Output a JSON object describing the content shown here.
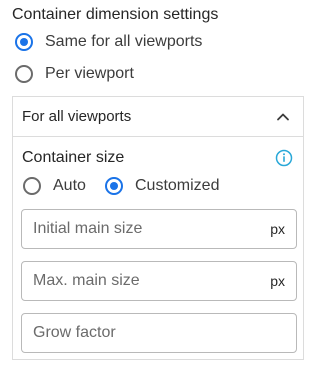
{
  "container_settings": {
    "title": "Container dimension settings",
    "viewport_options": [
      {
        "label": "Same for all viewports",
        "checked": true
      },
      {
        "label": "Per viewport",
        "checked": false
      }
    ]
  },
  "panel": {
    "header_label": "For all viewports",
    "header_icon": "chevron-up-icon",
    "container_size": {
      "title": "Container size",
      "info_icon": "info-icon",
      "options": [
        {
          "label": "Auto",
          "checked": false
        },
        {
          "label": "Customized",
          "checked": true
        }
      ]
    },
    "fields": [
      {
        "placeholder": "Initial main size",
        "value": "",
        "unit": "px"
      },
      {
        "placeholder": "Max. main size",
        "value": "",
        "unit": "px"
      },
      {
        "placeholder": "Grow factor",
        "value": "",
        "unit": ""
      }
    ]
  },
  "colors": {
    "accent": "#1a73e8",
    "info": "#29a8d8",
    "border": "#dcdcdc"
  }
}
